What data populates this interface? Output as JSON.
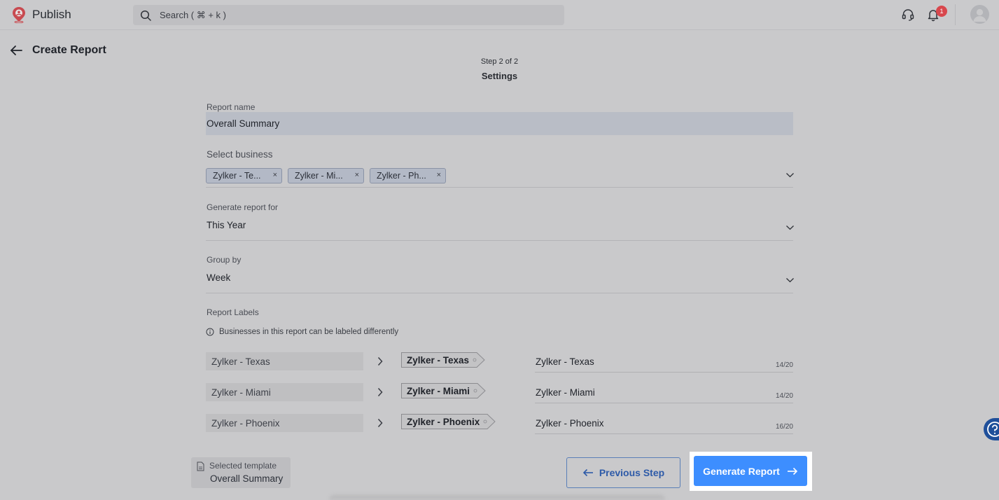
{
  "app": {
    "name": "Publish",
    "accent": "#3d8eff",
    "logo_icon": "publish-pin-logo-icon"
  },
  "search": {
    "placeholder": "Search ( ⌘ + k )"
  },
  "topbar": {
    "notification_count": "1",
    "icons": [
      "headset-icon",
      "bell-icon",
      "user-avatar-icon"
    ]
  },
  "page": {
    "title": "Create Report",
    "step": "Step 2 of 2",
    "step_name": "Settings"
  },
  "form": {
    "report_name": {
      "label": "Report name",
      "value": "Overall Summary"
    },
    "select_business": {
      "label": "Select business",
      "chips": [
        "Zylker - Te...",
        "Zylker - Mi...",
        "Zylker - Ph..."
      ],
      "remove_symbol": "×"
    },
    "generate_for": {
      "label": "Generate report for",
      "value": "This Year"
    },
    "group_by": {
      "label": "Group by",
      "value": "Week"
    },
    "report_labels": {
      "label": "Report Labels",
      "info": "Businesses in this report can be labeled differently",
      "rows": [
        {
          "business": "Zylker - Texas",
          "tag": "Zylker - Texas",
          "label_value": "Zylker - Texas",
          "count": "14/20"
        },
        {
          "business": "Zylker - Miami",
          "tag": "Zylker - Miami",
          "label_value": "Zylker - Miami",
          "count": "14/20"
        },
        {
          "business": "Zylker - Phoenix",
          "tag": "Zylker - Phoenix",
          "label_value": "Zylker - Phoenix",
          "count": "16/20"
        }
      ]
    }
  },
  "footer": {
    "template_label": "Selected template",
    "template_name": "Overall Summary",
    "previous_label": "Previous Step",
    "generate_label": "Generate Report"
  }
}
